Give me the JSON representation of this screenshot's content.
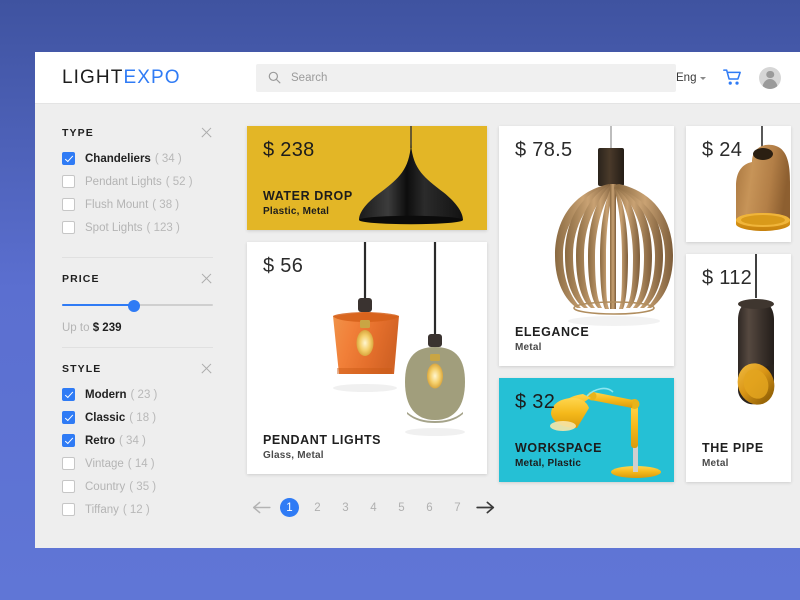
{
  "header": {
    "logo_light": "LIGHT",
    "logo_expo": "EXPO",
    "search_placeholder": "Search",
    "search_value": "",
    "language": "Eng"
  },
  "sidebar": {
    "filters": [
      {
        "title": "TYPE",
        "options": [
          {
            "label": "Chandeliers",
            "count": "( 34 )",
            "checked": true
          },
          {
            "label": "Pendant Lights",
            "count": "( 52 )",
            "checked": false
          },
          {
            "label": "Flush Mount",
            "count": "( 38 )",
            "checked": false
          },
          {
            "label": "Spot Lights",
            "count": "( 123 )",
            "checked": false
          }
        ]
      },
      {
        "title": "PRICE",
        "slider_percent": 48,
        "caption_prefix": "Up to",
        "caption_value": "$ 239"
      },
      {
        "title": "STYLE",
        "options": [
          {
            "label": "Modern",
            "count": "( 23 )",
            "checked": true
          },
          {
            "label": "Classic",
            "count": "( 18 )",
            "checked": true
          },
          {
            "label": "Retro",
            "count": "( 34 )",
            "checked": true
          },
          {
            "label": "Vintage",
            "count": "( 14 )",
            "checked": false
          },
          {
            "label": "Country",
            "count": "( 35 )",
            "checked": false
          },
          {
            "label": "Tiffany",
            "count": "( 12 )",
            "checked": false
          }
        ]
      }
    ]
  },
  "products": {
    "waterdrop": {
      "price": "$ 238",
      "title": "WATER DROP",
      "materials": "Plastic, Metal"
    },
    "pendant": {
      "price": "$ 56",
      "title": "PENDANT LIGHTS",
      "materials": "Glass, Metal"
    },
    "elegance": {
      "price": "$ 78.5",
      "title": "ELEGANCE",
      "materials": "Metal"
    },
    "workspace": {
      "price": "$ 32",
      "title": "WORKSPACE",
      "materials": "Metal, Plastic"
    },
    "wood": {
      "price": "$ 24",
      "title": "",
      "materials": ""
    },
    "pipe": {
      "price": "$ 112",
      "title": "THE PIPE",
      "materials": "Metal"
    }
  },
  "pagination": {
    "pages": [
      "1",
      "2",
      "3",
      "4",
      "5",
      "6",
      "7"
    ],
    "active": "1"
  },
  "colors": {
    "accent_blue": "#2f7bf5",
    "page_background": "#5b6fd0",
    "panel_background": "#eeeeee",
    "card_yellow": "#e3b626",
    "card_teal": "#25c0d5"
  }
}
